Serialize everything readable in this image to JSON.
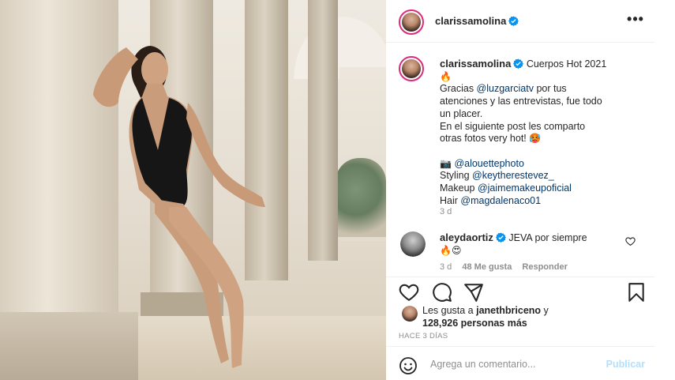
{
  "post": {
    "author": {
      "username": "clarissamolina",
      "verified": true
    },
    "more_label": "•••"
  },
  "caption": {
    "title": "Cuerpos Hot 2021",
    "title_emoji": "🔥",
    "line1_prefix": "Gracias ",
    "line1_mention": "@luzgarciatv",
    "line1_suffix": " por tus",
    "line2": "atenciones y las entrevistas, fue todo",
    "line3": "un placer.",
    "line4": "En el siguiente post les comparto",
    "line5": "otras fotos very hot! ",
    "line5_emoji": "🥵",
    "credits": [
      {
        "label": "📷",
        "mention": "@alouettephoto"
      },
      {
        "label": "Styling",
        "mention": "@keytherestevez_"
      },
      {
        "label": "Makeup",
        "mention": "@jaimemakeupoficial"
      },
      {
        "label": "Hair",
        "mention": "@magdalenaco01"
      }
    ],
    "time": "3 d"
  },
  "comment": {
    "username": "aleydaortiz",
    "verified": true,
    "text": "JEVA por siempre",
    "emojis": "🔥😍",
    "time": "3 d",
    "likes": "48 Me gusta",
    "reply_label": "Responder"
  },
  "likes": {
    "prefix": "Les gusta a ",
    "first_user": "janethbriceno",
    "conjunction": " y",
    "count_text": "128,926 personas más"
  },
  "post_time": "HACE 3 DÍAS",
  "comment_input": {
    "placeholder": "Agrega un comentario...",
    "submit_label": "Publicar"
  },
  "colors": {
    "verified_blue": "#0095f6",
    "link_blue": "#00376b",
    "publish_disabled": "#b2dffc",
    "story_ring": "#dd2a7b"
  },
  "icons": [
    "heart-icon",
    "comment-icon",
    "share-icon",
    "bookmark-icon",
    "emoji-icon",
    "verified-badge-icon",
    "camera-emoji"
  ]
}
